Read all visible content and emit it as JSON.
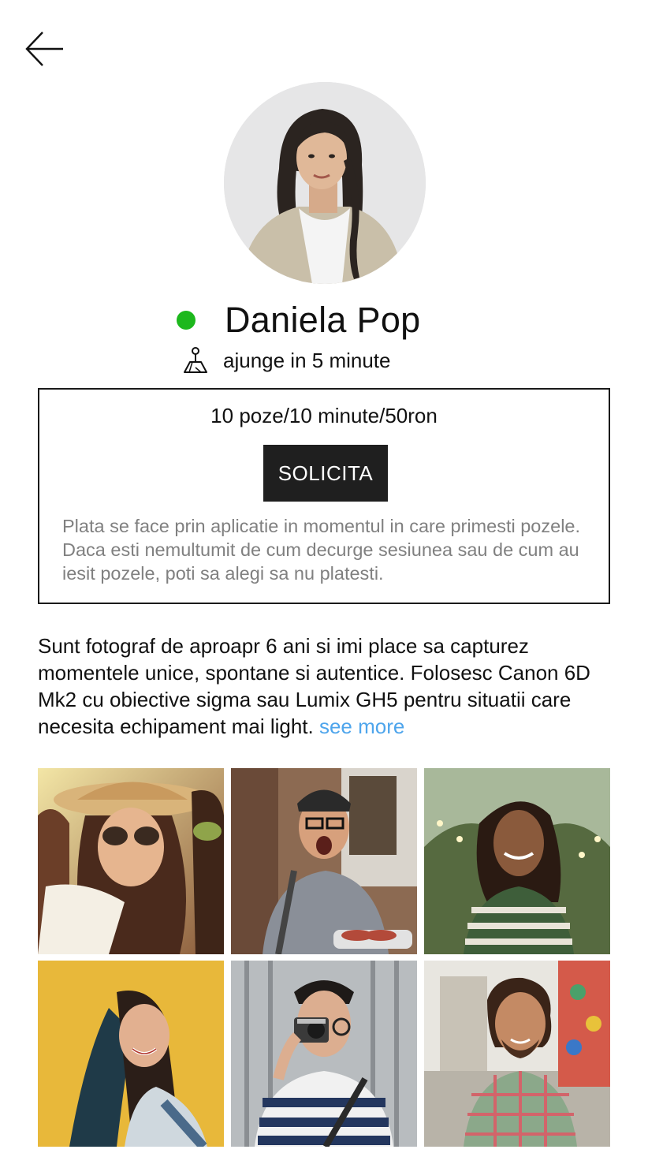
{
  "header": {
    "back_icon": "arrow-left-icon"
  },
  "profile": {
    "name": "Daniela Pop",
    "status": "online",
    "status_color": "#1db81d",
    "avatar_icon": "profile-photo",
    "eta_icon": "map-person-icon",
    "eta_text": "ajunge in 5 minute"
  },
  "offer": {
    "price_text": "10 poze/10 minute/50ron",
    "button_label": "SOLICITA",
    "note": "Plata se face prin aplicatie in momentul in care primesti pozele. Daca esti nemultumit de cum decurge sesiunea sau de cum au iesit pozele, poti sa alegi sa nu platesti."
  },
  "bio": {
    "text": "Sunt fotograf de aproapr 6 ani si imi place sa capturez momentele unice, spontane si autentice. Folosesc Canon 6D Mk2 cu obiective sigma sau Lumix GH5 pentru situatii care necesita echipament mai light. ",
    "link_label": "see more",
    "link_color": "#4ea5ec"
  },
  "gallery": {
    "photos": [
      {
        "icon": "selfie-photo"
      },
      {
        "icon": "grill-photo"
      },
      {
        "icon": "portrait-lights-photo"
      },
      {
        "icon": "yellow-wall-portrait-photo"
      },
      {
        "icon": "camera-man-photo"
      },
      {
        "icon": "street-portrait-photo"
      }
    ]
  }
}
